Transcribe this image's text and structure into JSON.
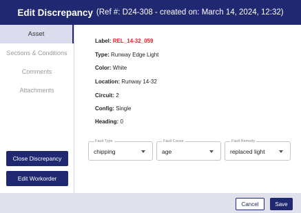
{
  "header": {
    "title": "Edit Discrepancy",
    "subtitle": "(Ref #: D24-308 - created on: March 14, 2024, 12:32)"
  },
  "sidebar": {
    "items": [
      {
        "label": "Asset",
        "active": true
      },
      {
        "label": "Sections & Conditions",
        "active": false
      },
      {
        "label": "Comments",
        "active": false
      },
      {
        "label": "Attachments",
        "active": false
      }
    ],
    "close_button": "Close Discrepancy",
    "edit_workorder_button": "Edit Workorder"
  },
  "details": {
    "label_key": "Label:",
    "label_value": "REL_14-32_059",
    "type_key": "Type:",
    "type_value": "Runway Edge Light",
    "color_key": "Color:",
    "color_value": "White",
    "location_key": "Location:",
    "location_value": "Runway 14-32",
    "circuit_key": "Circuit:",
    "circuit_value": "2",
    "config_key": "Config:",
    "config_value": "Single",
    "heading_key": "Heading:",
    "heading_value": "0"
  },
  "selects": {
    "fault_type": {
      "legend": "Fault Type",
      "value": "chipping"
    },
    "fault_cause": {
      "legend": "Fault Cause",
      "value": "age"
    },
    "fault_remedy": {
      "legend": "Fault Remedy",
      "value": "replaced light"
    }
  },
  "footer": {
    "cancel_label": "Cancel",
    "save_label": "Save"
  },
  "colors": {
    "primary": "#1f2870",
    "label_red": "#e3222a",
    "active_tab_bg": "#dcdcef",
    "footer_bg": "#e0e1ec"
  }
}
